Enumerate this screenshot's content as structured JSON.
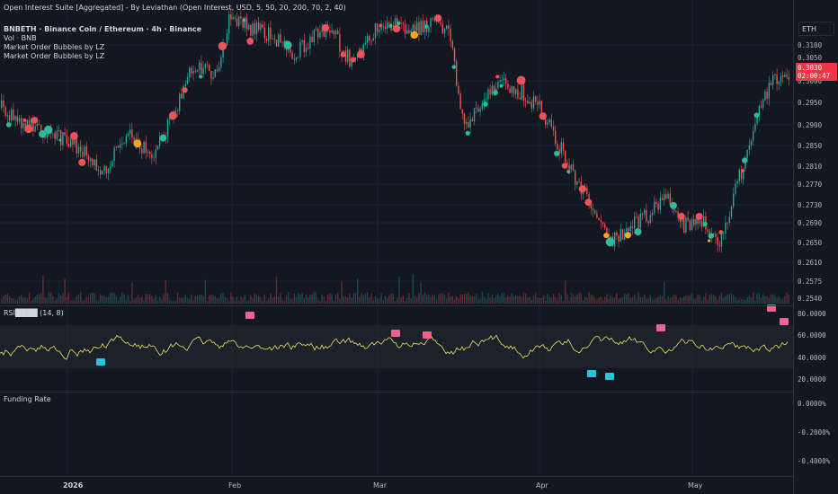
{
  "header": {
    "indicator_title": "Open Interest Suite [Aggregated] - By Leviathan (Open Interest, USD, 5, 50, 20, 200, 70, 2, 40)"
  },
  "legend": {
    "symbol": "BNBETH · Binance Coin / Ethereum · 4h · Binance",
    "volume": "Vol · BNB",
    "bubbles_1": "Market Order Bubbles by LZ",
    "bubbles_2": "Market Order Bubbles by LZ"
  },
  "rsi_pane": {
    "label": "RSI████ (14, 8)",
    "ticks": [
      "80.0000",
      "60.0000",
      "40.0000",
      "20.0000"
    ]
  },
  "funding_pane": {
    "label": "Funding Rate",
    "ticks": [
      "0.0000%",
      "-0.2000%",
      "-0.4000%"
    ]
  },
  "right_axis": {
    "ticker": "ETH",
    "price_ticks": [
      "0.3100",
      "0.3050",
      "0.3000",
      "0.2950",
      "0.2900",
      "0.2850",
      "0.2810",
      "0.2770",
      "0.2730",
      "0.2690",
      "0.2650",
      "0.2610",
      "0.2575",
      "0.2540"
    ],
    "current_price": "0.3030",
    "countdown": "02:00:47"
  },
  "time_axis": [
    "2026",
    "Feb",
    "Mar",
    "Apr",
    "May"
  ],
  "colors": {
    "up": "#26a69a",
    "down": "#ef5350",
    "rsi": "#e8e35a",
    "tag": "#f23645",
    "bg": "#131722"
  }
}
